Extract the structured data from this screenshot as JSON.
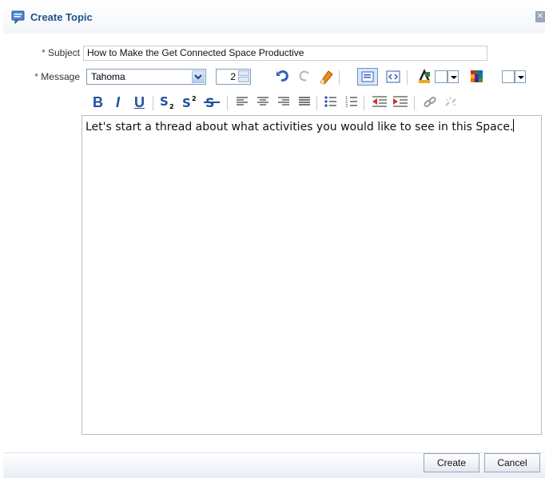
{
  "dialog": {
    "title": "Create Topic",
    "close_glyph": "✕"
  },
  "form": {
    "subject_label": "Subject",
    "message_label": "Message",
    "required_mark": "*",
    "subject_value": "How to Make the Get Connected Space Productive",
    "font_value": "Tahoma",
    "size_value": "2",
    "message_text": "Let's start a thread about what activities you would like to see in this Space."
  },
  "toolbar": {
    "icons": [
      "undo-icon",
      "redo-icon",
      "eraser-icon",
      "rich-text-mode-icon",
      "source-mode-icon",
      "text-color-icon",
      "background-color-icon"
    ],
    "format": [
      "bold",
      "italic",
      "underline",
      "subscript",
      "superscript",
      "strikethrough",
      "align-left",
      "align-center",
      "align-right",
      "justify",
      "bullet-list",
      "numbered-list",
      "outdent",
      "indent",
      "link",
      "unlink"
    ]
  },
  "buttons": {
    "create": "Create",
    "cancel": "Cancel"
  },
  "colors": {
    "title": "#23508f",
    "format_icons": "#1f4fa0"
  }
}
